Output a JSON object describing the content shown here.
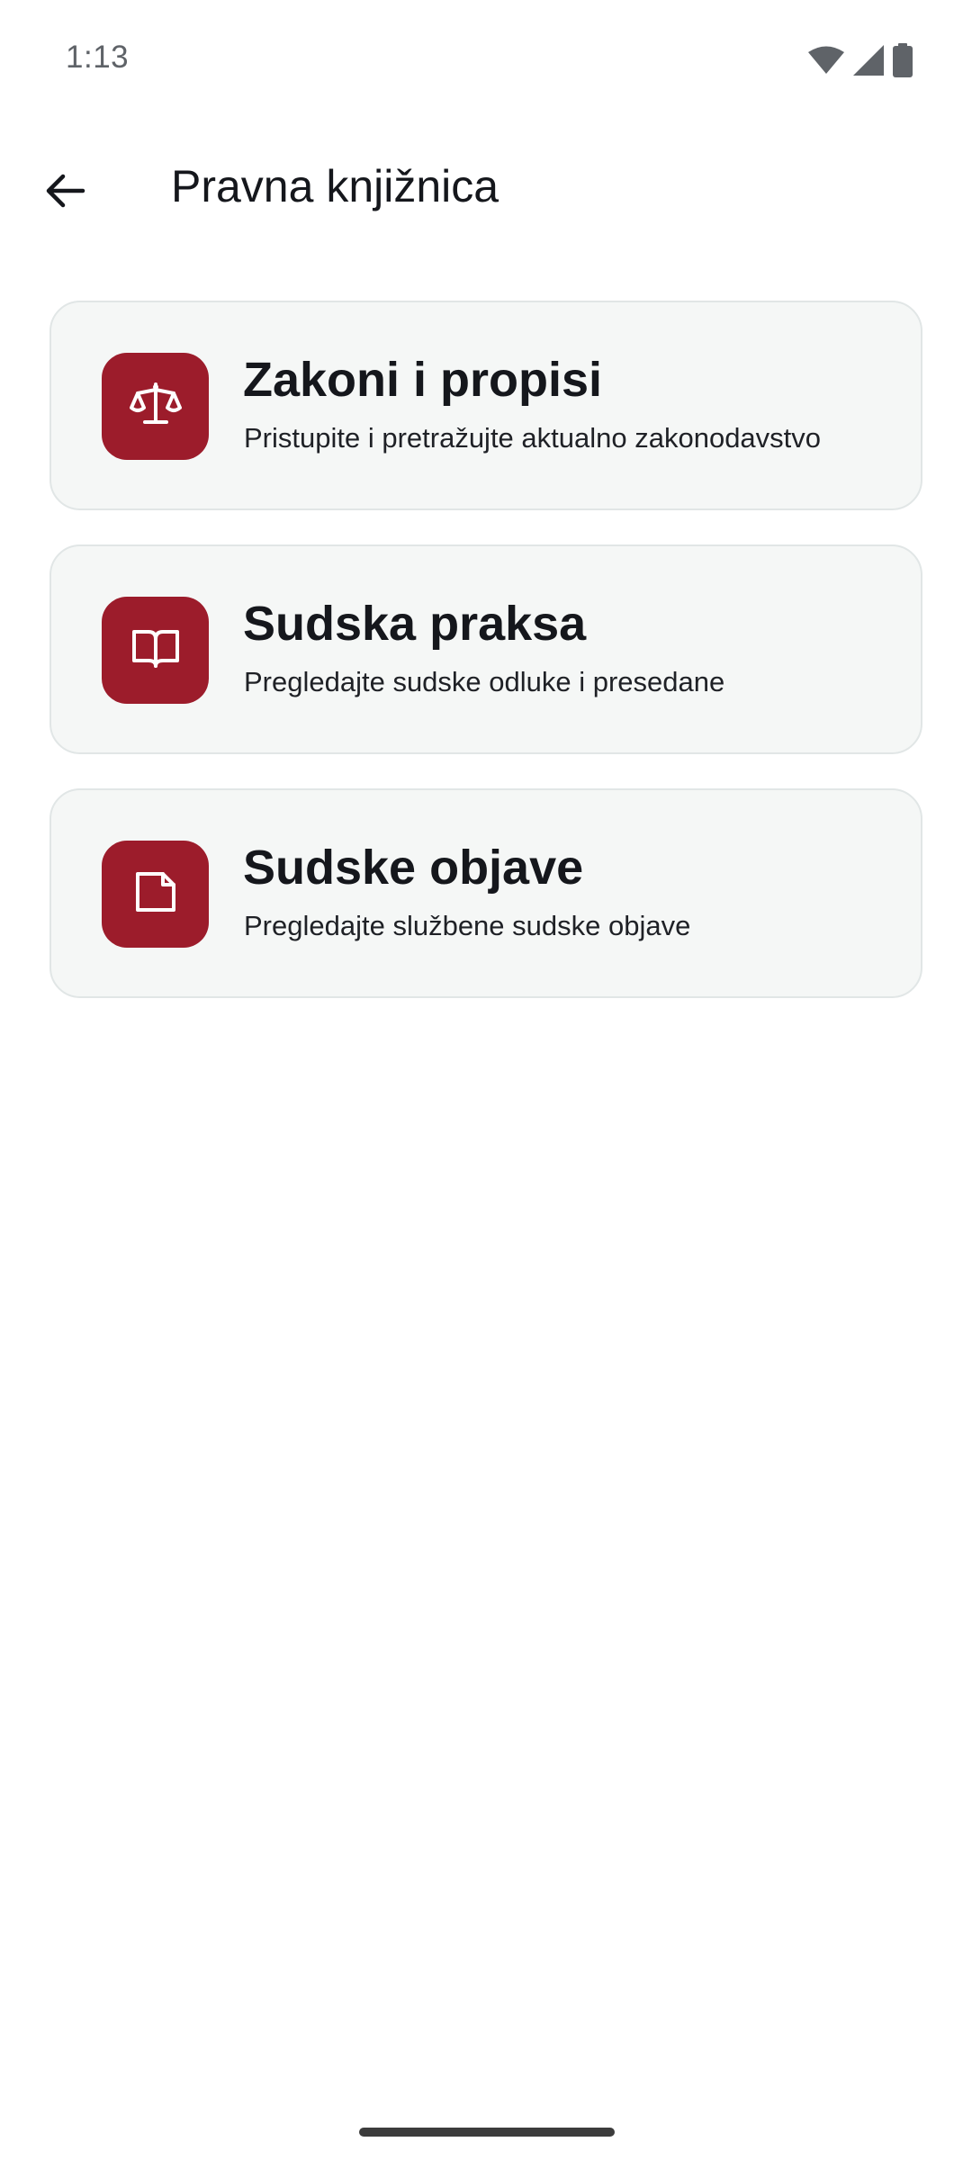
{
  "status_bar": {
    "time": "1:13",
    "icons": [
      "wifi-icon",
      "signal-icon",
      "battery-icon"
    ],
    "icon_color": "#5f6368"
  },
  "app_bar": {
    "title": "Pravna knjižnica",
    "back_icon": "arrow-left-icon"
  },
  "colors": {
    "accent": "#9c1c2b",
    "card_background": "#f5f7f6",
    "card_border": "#e1e6e6",
    "text_primary": "#15171c"
  },
  "cards": [
    {
      "icon": "scales-icon",
      "title": "Zakoni i propisi",
      "subtitle": "Pristupite i pretražujte aktualno zakonodavstvo"
    },
    {
      "icon": "open-book-icon",
      "title": "Sudska praksa",
      "subtitle": "Pregledajte sudske odluke i presedane"
    },
    {
      "icon": "document-icon",
      "title": "Sudske objave",
      "subtitle": "Pregledajte službene sudske objave"
    }
  ]
}
